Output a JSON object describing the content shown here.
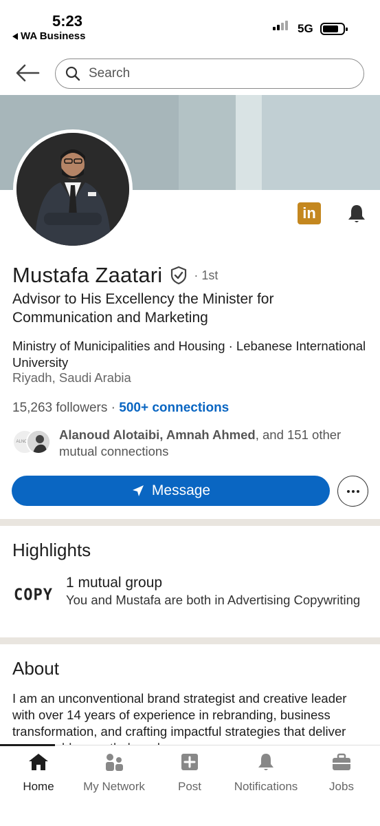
{
  "status_bar": {
    "time": "5:23",
    "back_app": "WA Business",
    "network": "5G"
  },
  "search": {
    "placeholder": "Search"
  },
  "profile": {
    "name": "Mustafa Zaatari",
    "degree": "· 1st",
    "headline": "Advisor to His Excellency the Minister for Communication and Marketing",
    "workplace": "Ministry of Municipalities and Housing · Lebanese International University",
    "location": "Riyadh, Saudi Arabia",
    "followers": "15,263 followers",
    "separator": " · ",
    "connections": "500+ connections",
    "mutual_names": "Alanoud Alotaibi, Amnah Ahmed",
    "mutual_rest": ", and 151 other mutual connections"
  },
  "actions": {
    "message_label": "Message"
  },
  "highlights": {
    "title": "Highlights",
    "logo_text": "COPY",
    "item_title": "1 mutual group",
    "item_desc": "You and Mustafa are both in Advertising Copywriting"
  },
  "about": {
    "title": "About",
    "text": "I am an unconventional brand strategist and creative leader with over 14 years of experience in rebranding, business transformation, and crafting impactful strategies that deliver measurable growth, brand"
  },
  "bottom_nav": {
    "items": [
      {
        "label": "Home",
        "icon": "home-icon"
      },
      {
        "label": "My Network",
        "icon": "network-icon"
      },
      {
        "label": "Post",
        "icon": "post-icon"
      },
      {
        "label": "Notifications",
        "icon": "bell-icon"
      },
      {
        "label": "Jobs",
        "icon": "briefcase-icon"
      }
    ]
  },
  "colors": {
    "accent": "#0a66c2",
    "badge": "#c4871f",
    "banner": "#a7b6ba"
  }
}
